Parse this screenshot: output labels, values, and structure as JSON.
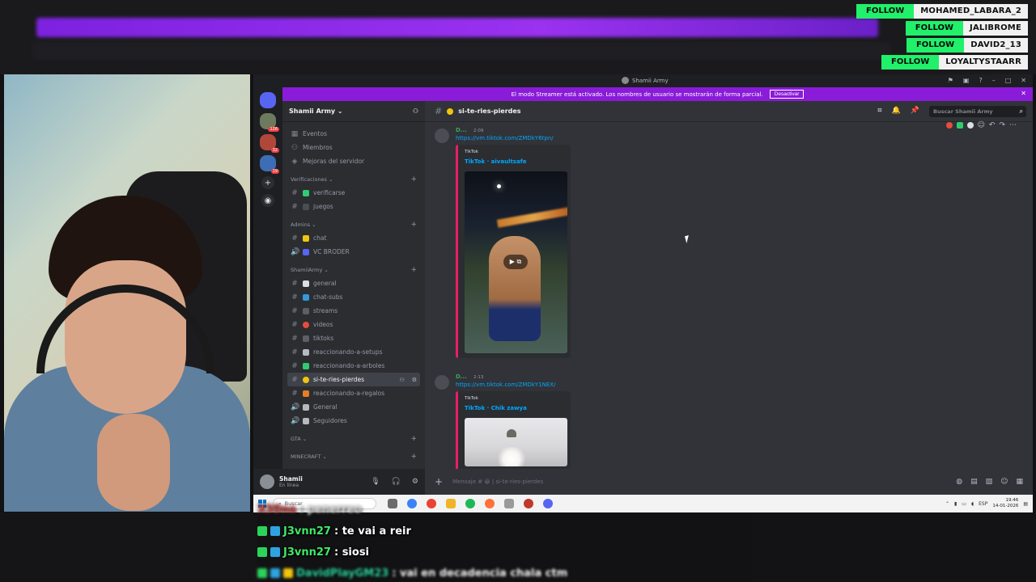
{
  "follows": [
    {
      "tag": "FOLLOW",
      "name": "MOHAMED_LABARA_2"
    },
    {
      "tag": "FOLLOW",
      "name": "JALIBROME"
    },
    {
      "tag": "FOLLOW",
      "name": "DAVID2_13"
    },
    {
      "tag": "FOLLOW",
      "name": "LOYALTYSTAARR"
    }
  ],
  "window": {
    "title": "Shamii Army",
    "streamer_notice": "El modo Streamer está activado. Los nombres de usuario se mostrarán de forma parcial.",
    "streamer_button": "Desactivar",
    "close": "✕"
  },
  "rail": {
    "badges": [
      "126",
      "32",
      "19"
    ]
  },
  "server": {
    "name": "Shamii Army ⌄"
  },
  "sidebar": {
    "top_items": [
      "Eventos",
      "Miembros",
      "Mejoras del servidor"
    ],
    "categories": [
      {
        "name": "Verificaciones ⌄",
        "plus": "+"
      },
      {
        "name": "Admins ⌄",
        "plus": "+"
      },
      {
        "name": "ShamiiArmy ⌄",
        "plus": "+"
      },
      {
        "name": "GTA ⌄",
        "plus": "+"
      },
      {
        "name": "MINECRAFT ⌄",
        "plus": "+"
      }
    ],
    "channels": [
      {
        "prefix": "#",
        "name": "verificarse",
        "color": "#2ecc71"
      },
      {
        "prefix": "#",
        "name": "juegos",
        "color": "#4a4d53"
      },
      {
        "prefix": "#",
        "name": "chat",
        "color": "#f1c40f"
      },
      {
        "prefix": "🔊",
        "name": "VC BRODER",
        "color": "#5865f2"
      },
      {
        "prefix": "#",
        "name": "general",
        "color": "#dbdee1"
      },
      {
        "prefix": "#",
        "name": "chat-subs",
        "color": "#3498db"
      },
      {
        "prefix": "#",
        "name": "streams",
        "color": "#5c5f66"
      },
      {
        "prefix": "#",
        "name": "videos",
        "color": "#e74c3c"
      },
      {
        "prefix": "#",
        "name": "tiktoks",
        "color": "#5c5f66"
      },
      {
        "prefix": "#",
        "name": "reaccionando-a-setups",
        "color": "#b5bac1"
      },
      {
        "prefix": "#",
        "name": "reaccionando-a-arboles",
        "color": "#2ecc71"
      },
      {
        "prefix": "#",
        "name": "si-te-ries-pierdes",
        "color": "#f1c40f"
      },
      {
        "prefix": "#",
        "name": "reaccionando-a-regalos",
        "color": "#e67e22"
      },
      {
        "prefix": "🔊",
        "name": "General",
        "color": "#b5bac1"
      },
      {
        "prefix": "🔊",
        "name": "Seguidores",
        "color": "#b5bac1"
      }
    ]
  },
  "user": {
    "name": "Shamii",
    "status": "En línea"
  },
  "chat": {
    "channel": "si-te-ries-pierdes",
    "search_placeholder": "Buscar Shamii Army",
    "composer_placeholder": "Mensaje # 😀 | si-te-ries-pierdes",
    "messages": [
      {
        "author": "D...",
        "time": "2:09",
        "link": "https://vm.tiktok.com/ZMDkY6tpn/",
        "provider": "TikTok",
        "title": "TikTok · aivaultsafe"
      },
      {
        "author": "D...",
        "time": "2:13",
        "link": "https://vm.tiktok.com/ZMDkY1NEX/",
        "provider": "TikTok",
        "title": "TikTok · Chik zawya"
      }
    ]
  },
  "taskbar": {
    "search": "Buscar",
    "lang": "ESP",
    "time": "19:46",
    "date": "14-01-2026"
  },
  "stream_chat": [
    {
      "user": "X3Dna",
      "text": ": penerreo",
      "blurred": true
    },
    {
      "user": "J3vnn27",
      "text": ": te vai a reir",
      "blurred": false
    },
    {
      "user": "J3vnn27",
      "text": ": siosi",
      "blurred": false
    },
    {
      "user": "DavidPlayGM23",
      "text": ": vai en decadencia chala ctm",
      "blurred": true
    }
  ]
}
